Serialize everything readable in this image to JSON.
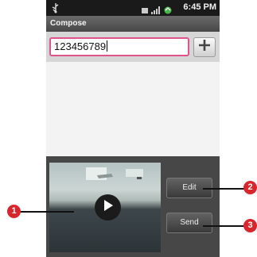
{
  "status_bar": {
    "time": "6:45 PM",
    "usb_icon": "usb-icon",
    "icons": [
      "notification-icon",
      "signal-icon",
      "battery-icon"
    ]
  },
  "header": {
    "title": "Compose"
  },
  "recipient": {
    "value": "123456789",
    "add_icon": "plus-icon"
  },
  "attachment": {
    "play_icon": "play-icon",
    "edit_label": "Edit",
    "send_label": "Send"
  },
  "callouts": [
    "1",
    "2",
    "3"
  ],
  "colors": {
    "callout": "#d9262c",
    "field_border": "#e0538c",
    "status_bar": "#1a1a1a",
    "panel": "#474747"
  }
}
